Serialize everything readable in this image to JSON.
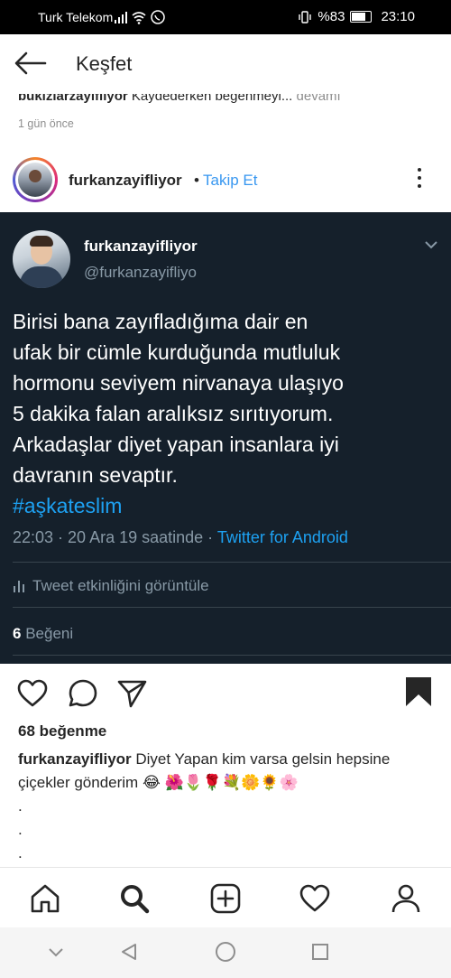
{
  "status": {
    "carrier": "Turk Telekom",
    "battery": "%83",
    "time": "23:10"
  },
  "header": {
    "title": "Keşfet"
  },
  "previous_comment": {
    "user": "bukiziarzayifliyor",
    "text": "Kaydederken begenmeyi...",
    "more": "devamı",
    "ago": "1 gün önce"
  },
  "post": {
    "username": "furkanzayifliyor",
    "separator": "•",
    "follow": "Takip Et"
  },
  "tweet": {
    "name": "furkanzayifliyor",
    "handle": "@furkanzayifliyo",
    "lines": [
      "Birisi bana zayıfladığıma dair en",
      "ufak bir cümle kurduğunda mutluluk",
      "hormonu seviyem nirvanaya ulaşıyo",
      "5 dakika falan aralıksız sırıtıyorum.",
      "Arkadaşlar diyet yapan insanlara iyi",
      "davranın sevaptır."
    ],
    "hashtag": "#aşkateslim",
    "meta": "22:03 · 20 Ara 19 saatinde · ",
    "source": "Twitter for Android",
    "activity": "Tweet etkinliğini görüntüle",
    "like_count": "6",
    "like_label": " Beğeni"
  },
  "likes": "68 beğenme",
  "caption": {
    "user": "furkanzayifliyor",
    "text": " Diyet Yapan kim varsa gelsin hepsine çiçekler gönderim 😂 🌺🌷🌹💐🌼🌻🌸"
  },
  "dots": [
    ".",
    ".",
    "."
  ],
  "icons": {
    "nav": [
      "home-icon",
      "search-icon",
      "add-post-icon",
      "activity-heart-icon",
      "profile-icon"
    ],
    "system": [
      "collapse-icon",
      "back-triangle-icon",
      "home-circle-icon",
      "recents-square-icon"
    ]
  },
  "colors": {
    "link": "#3897f0",
    "tweet_bg": "#15202b",
    "twitter_blue": "#1da1f2"
  }
}
